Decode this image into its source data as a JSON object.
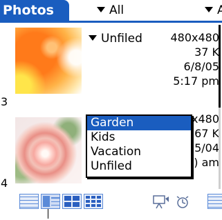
{
  "titlebar": {
    "app_title": "Photos",
    "picker_left": "All",
    "picker_right": "Al"
  },
  "photos": [
    {
      "index": "3",
      "category": "Unfiled",
      "resolution": "480x480",
      "size": "37 K",
      "date": "6/8/05",
      "time": "5:17 pm",
      "thumbnail": "orange-sunburst"
    },
    {
      "index": "4",
      "category": "",
      "resolution": "x480",
      "size": "67 K",
      "date": "5/04",
      "time": ") am",
      "thumbnail": "pink-rose"
    }
  ],
  "popup": {
    "options": [
      "Garden",
      "Kids",
      "Vacation",
      "Unfiled"
    ],
    "selected": "Garden"
  },
  "toolbar": {
    "buttons": [
      "list-view-icon",
      "detail-view-icon",
      "thumbnail-large-view-icon",
      "thumbnail-small-view-icon",
      "slideshow-icon",
      "timer-icon",
      "menu-icon"
    ],
    "selected": "detail-view-icon"
  },
  "colors": {
    "accent": "#1a5dbf",
    "selection": "#1a5dbf"
  }
}
